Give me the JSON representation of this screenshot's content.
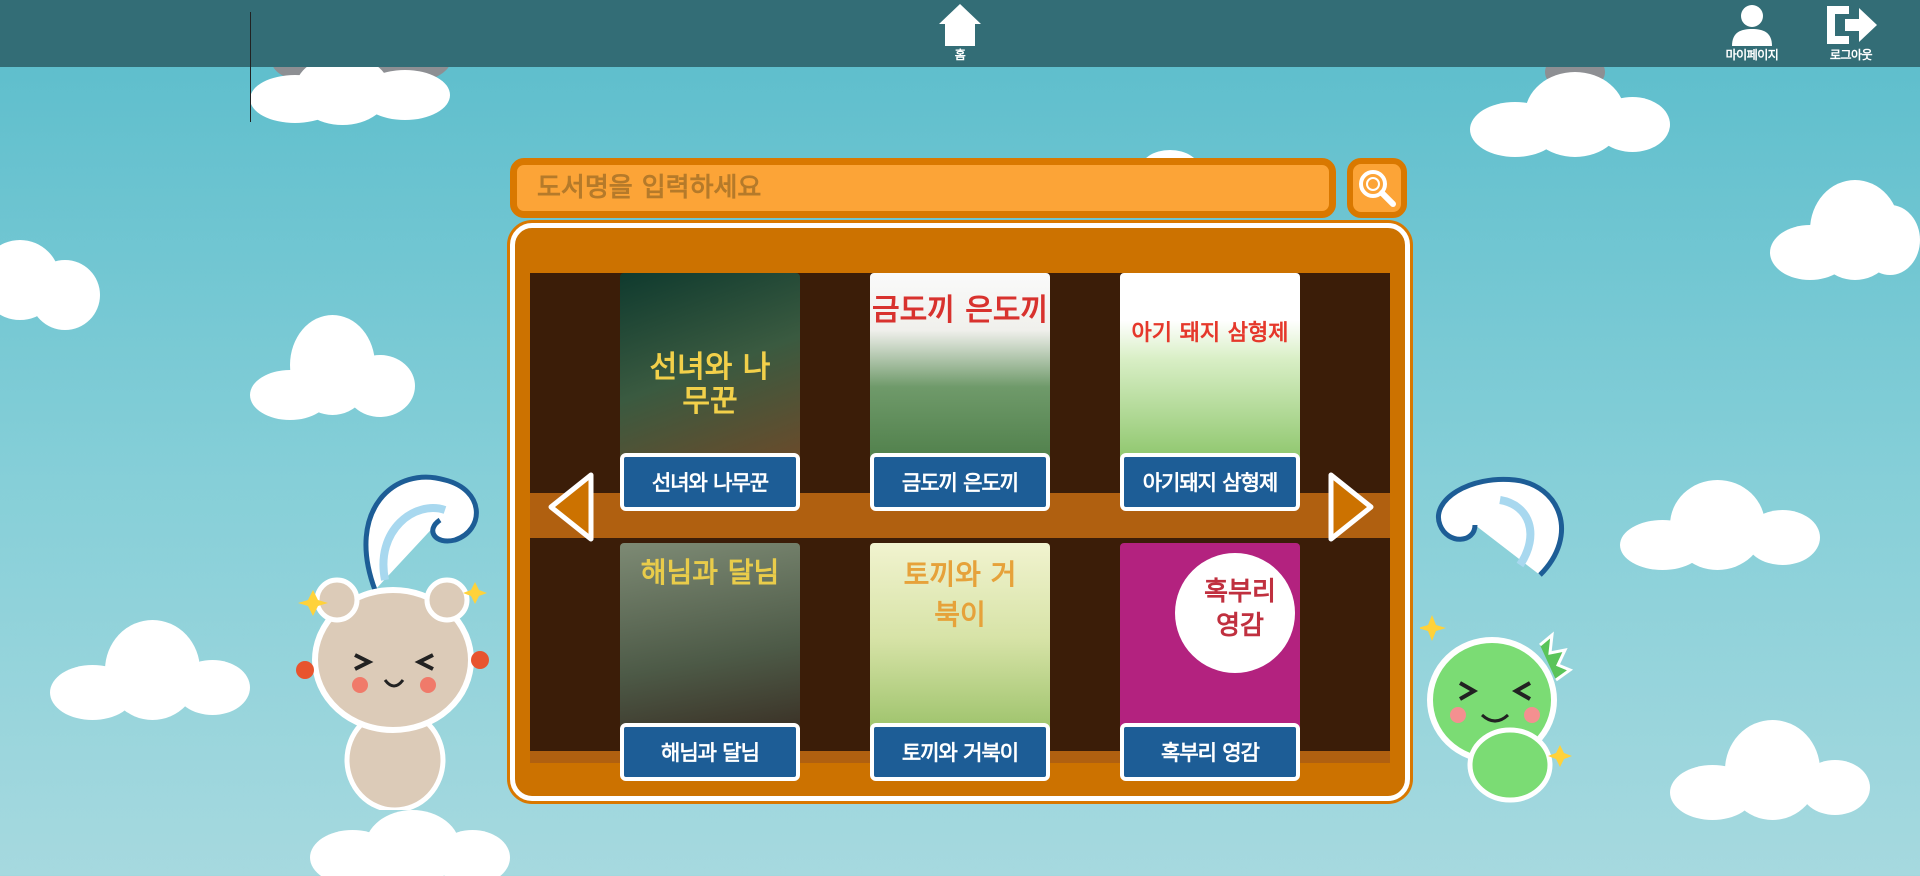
{
  "nav": {
    "home_label": "홈",
    "mypage_label": "마이페이지",
    "logout_label": "로그아웃"
  },
  "search": {
    "placeholder": "도서명을 입력하세요"
  },
  "books": [
    {
      "title": "선녀와 나무꾼",
      "cover_title": "선녀와 나무꾼",
      "cover_color": "#1e4a3a",
      "title_color": "#f2d04a"
    },
    {
      "title": "금도끼 은도끼",
      "cover_title": "금도끼 은도끼",
      "cover_color": "#d8e8d5",
      "title_color": "#d8322e"
    },
    {
      "title": "아기돼지 삼형제",
      "cover_title": "아기 돼지 삼형제",
      "cover_color": "#cfe9c4",
      "title_color": "#e5382b"
    },
    {
      "title": "해님과 달님",
      "cover_title": "해님과 달님",
      "cover_color": "#5a6a55",
      "title_color": "#e9cc4a"
    },
    {
      "title": "토끼와 거북이",
      "cover_title": "토끼와 거북이",
      "cover_color": "#d7e3a7",
      "title_color": "#e6a23a"
    },
    {
      "title": "혹부리 영감",
      "cover_title": "혹부리 영감",
      "cover_color": "#b3227f",
      "title_color": "#c0303f"
    }
  ],
  "icons": {
    "home": "home-icon",
    "mypage": "user-icon",
    "logout": "logout-icon",
    "search": "search-icon",
    "prev": "arrow-left-icon",
    "next": "arrow-right-icon"
  },
  "colors": {
    "topbar": "#336d76",
    "search_fill": "#fca437",
    "shelf": "#cc7200",
    "label": "#1d5d96"
  }
}
